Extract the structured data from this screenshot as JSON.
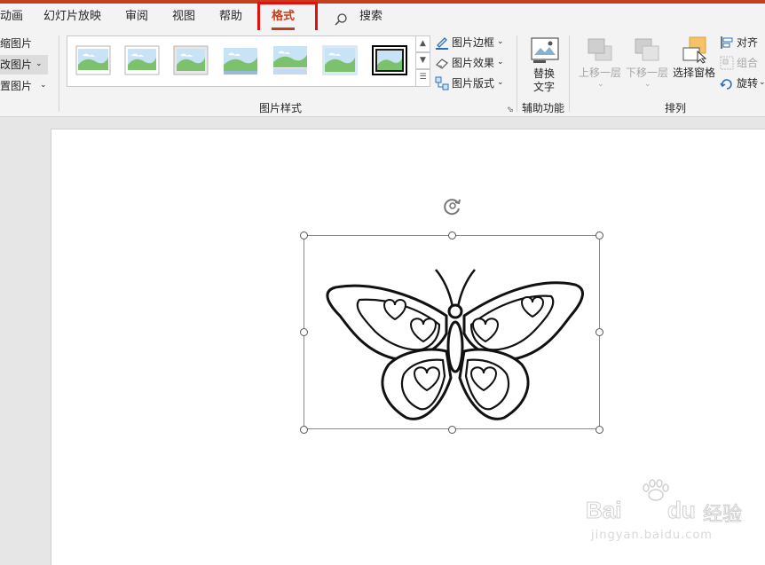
{
  "tabs": [
    {
      "label": "动画"
    },
    {
      "label": "幻灯片放映"
    },
    {
      "label": "审阅"
    },
    {
      "label": "视图"
    },
    {
      "label": "帮助"
    },
    {
      "label": "格式",
      "active": true
    },
    {
      "label": "搜索"
    }
  ],
  "ribbon": {
    "adjust": [
      "缩图片",
      "改图片",
      "置图片"
    ],
    "styles_group_label": "图片样式",
    "picture_border": "图片边框",
    "picture_effects": "图片效果",
    "picture_layout": "图片版式",
    "alt_text_line1": "替换",
    "alt_text_line2": "文字",
    "accessibility_label": "辅助功能",
    "bring_forward": "上移一层",
    "send_backward": "下移一层",
    "selection_pane": "选择窗格",
    "align": "对齐",
    "group": "组合",
    "rotate": "旋转",
    "arrange_label": "排列"
  },
  "watermark": {
    "brand": "Bai",
    "brand2": "du",
    "suffix": "经验",
    "url": "jingyan.baidu.com"
  },
  "colors": {
    "accent": "#c43e1c",
    "highlight": "#e01010"
  }
}
